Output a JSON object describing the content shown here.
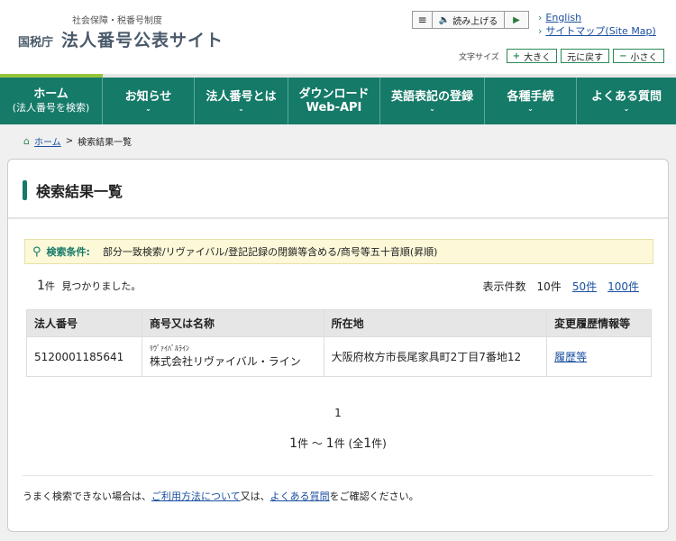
{
  "header": {
    "subtitle": "社会保障・税番号制度",
    "agency": "国税庁",
    "site_title": "法人番号公表サイト",
    "reader": {
      "menu_icon": "≡",
      "read_label": "読み上げる",
      "play_icon": "▶"
    },
    "links": {
      "english": "English",
      "sitemap": "サイトマップ(Site Map)"
    },
    "font_size": {
      "label": "文字サイズ",
      "larger": "大きく",
      "reset": "元に戻す",
      "smaller": "小さく"
    }
  },
  "nav": [
    {
      "line1": "ホーム",
      "line2": "(法人番号を検索)"
    },
    {
      "line1": "お知らせ",
      "line2": ""
    },
    {
      "line1": "法人番号とは",
      "line2": ""
    },
    {
      "line1": "ダウンロード",
      "line2": "Web-API"
    },
    {
      "line1": "英語表記の登録",
      "line2": ""
    },
    {
      "line1": "各種手続",
      "line2": ""
    },
    {
      "line1": "よくある質問",
      "line2": ""
    }
  ],
  "breadcrumb": {
    "home": "ホーム",
    "sep": ">",
    "current": "検索結果一覧"
  },
  "page_title": "検索結果一覧",
  "conditions": {
    "label": "検索条件:",
    "value": "部分一致検索/リヴァイバル/登記記録の閉鎖等含める/商号等五十音順(昇順)"
  },
  "result": {
    "count": "1",
    "count_unit": "件",
    "found_text": "見つかりました。"
  },
  "per_page": {
    "label": "表示件数",
    "current": "10件",
    "opt1": "50件",
    "opt2": "100件"
  },
  "table": {
    "headers": [
      "法人番号",
      "商号又は名称",
      "所在地",
      "変更履歴情報等"
    ],
    "rows": [
      {
        "number": "5120001185641",
        "kana": "ﾘｳﾞｧｲﾊﾞﾙﾗｲﾝ",
        "name": "株式会社リヴァイバル・ライン",
        "address": "大阪府枚方市長尾家具町2丁目7番地12",
        "history": "履歴等"
      }
    ]
  },
  "pager": {
    "page": "1",
    "from": "1",
    "to": "1",
    "unit": "件",
    "tilde": "～",
    "total_prefix": "(全",
    "total": "1",
    "total_suffix": "件)"
  },
  "footer_note": {
    "prefix": "うまく検索できない場合は、",
    "link1": "ご利用方法について",
    "mid": "又は、",
    "link2": "よくある質問",
    "suffix": "をご確認ください。"
  },
  "colors": {
    "nav_bg": "#157a68",
    "accent_green": "#95c43c",
    "link": "#1a4fa0",
    "notice_bg": "#fdf8d8"
  }
}
